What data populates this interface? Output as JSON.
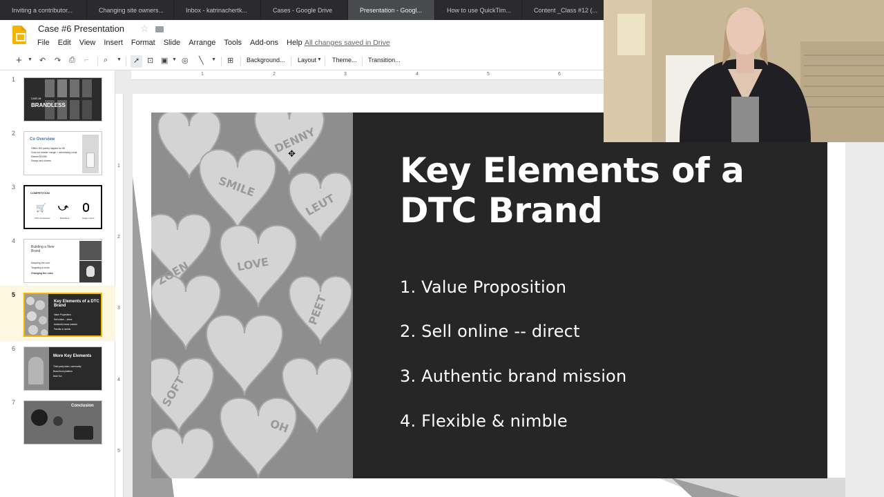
{
  "browser": {
    "tabs": [
      {
        "label": "Inviting a contributor..."
      },
      {
        "label": "Changing site owners..."
      },
      {
        "label": "Inbox - katrinachertk..."
      },
      {
        "label": "Cases - Google Drive"
      },
      {
        "label": "Presentation - Googl..."
      },
      {
        "label": "How to use QuickTim..."
      },
      {
        "label": "Content _Class #12 (..."
      }
    ],
    "active_tab_index": 4
  },
  "doc": {
    "title": "Case #6 Presentation",
    "save_status": "All changes saved in Drive"
  },
  "menu": [
    "File",
    "Edit",
    "View",
    "Insert",
    "Format",
    "Slide",
    "Arrange",
    "Tools",
    "Add-ons",
    "Help"
  ],
  "toolbar": {
    "background_label": "Background...",
    "layout_label": "Layout",
    "theme_label": "Theme...",
    "transition_label": "Transition..."
  },
  "ruler": {
    "h_numbers": [
      "1",
      "2",
      "3",
      "4",
      "5",
      "6"
    ],
    "v_numbers": [
      "1",
      "2",
      "3",
      "4",
      "5"
    ]
  },
  "filmstrip": {
    "selected_index": 5,
    "slides": [
      {
        "number": "1",
        "title": "BRANDLESS",
        "subtitle": "CASE #6"
      },
      {
        "number": "2",
        "title": "Co Overview",
        "lines": [
          "Offers 300 pantry staples for $3",
          "Cuts out retailer margin + advertising costs",
          "Raised $240M",
          "Swaps and shares"
        ]
      },
      {
        "number": "3",
        "title": "COMPETITION",
        "labels": [
          "CPG Companies",
          "Brandless",
          "Happy Users"
        ]
      },
      {
        "number": "4",
        "title": "Building a New Brand",
        "lines": [
          "Adopting the core",
          "Targeting a niche",
          "Changing the rules"
        ]
      },
      {
        "number": "5",
        "title": "Key Elements of a DTC Brand",
        "lines": [
          "Value Proposition",
          "Sell online -- direct",
          "Authentic brand mission",
          "Flexible & nimble"
        ]
      },
      {
        "number": "6",
        "title": "More Key Elements",
        "lines": [
          "Third-party data / community",
          "Brand trust platform",
          "More fun"
        ]
      },
      {
        "number": "7",
        "title": "Conclusion"
      }
    ]
  },
  "slide": {
    "title_line1": "Key Elements of a",
    "title_line2": "DTC Brand",
    "bullets": [
      "1. Value Proposition",
      "2. Sell online -- direct",
      "3. Authentic brand mission",
      "4. Flexible & nimble"
    ],
    "candy_words": [
      "DENNY",
      "SMILE",
      "LEUT",
      "ZOEN",
      "LOVE",
      "PEET",
      "SOFT",
      "OH"
    ]
  },
  "colors": {
    "accent": "#f4b400",
    "slide_panel": "#262626",
    "tab_bar": "#2b2b2e"
  }
}
